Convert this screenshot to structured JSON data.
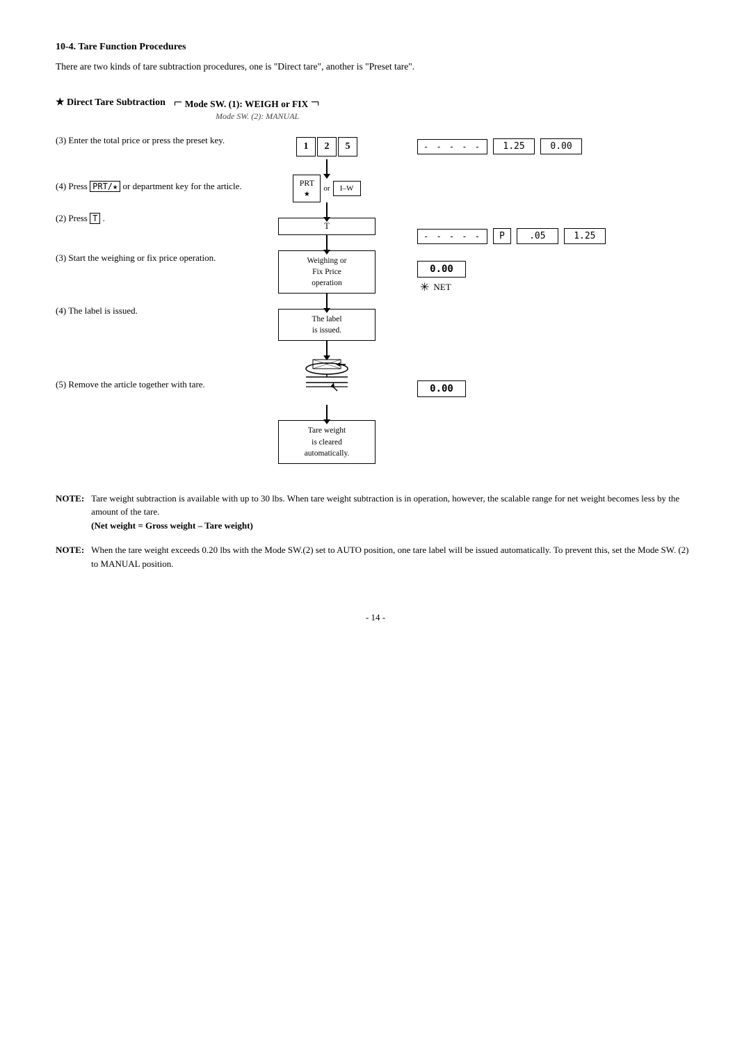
{
  "section": {
    "title": "10-4. Tare Function Procedures",
    "intro": "There are two kinds of tare subtraction procedures, one is \"Direct tare\", another is \"Preset tare\"."
  },
  "direct_tare": {
    "star_label": "★ Direct Tare Subtraction",
    "mode_label": "Mode SW. (1): WEIGH or FIX",
    "mode_sub": "Mode SW. (2): MANUAL"
  },
  "steps": [
    {
      "num": "(3)",
      "text": "Enter the total price or press the preset key."
    },
    {
      "num": "(4)",
      "text": "Press PRT/* or department key for the article."
    },
    {
      "num": "(2)",
      "text": "Press T ."
    },
    {
      "num": "(3)",
      "text": "Start the weighing or fix price operation."
    },
    {
      "num": "(4)",
      "text": "The label is issued."
    },
    {
      "num": "(5)",
      "text": "Remove the article together with tare."
    }
  ],
  "flowchart": {
    "keypad_digits": [
      "1",
      "2",
      "5"
    ],
    "node_prt": "PRT",
    "node_or": "or",
    "node_dept": "I-W",
    "node_t": "T",
    "node_weighing": [
      "Weighing or",
      "Fix Price",
      "operation"
    ],
    "node_label_issued": [
      "The label",
      "is issued."
    ],
    "node_tare_cleared": [
      "Tare weight",
      "is cleared",
      "automatically."
    ]
  },
  "readouts": {
    "row1_dots": "- - - - -",
    "row1_price": "1.25",
    "row1_total": "0.00",
    "row2_dots": "- - - - -",
    "row2_p": "P",
    "row2_val1": ".05",
    "row2_val2": "1.25",
    "row3_weight": "0.00",
    "net_label": "NET",
    "tare_cleared_val": "0.00"
  },
  "notes": [
    {
      "label": "NOTE:",
      "text": "Tare weight subtraction is available with up to 30 lbs. When tare weight subtraction is in operation, however, the scalable range for net weight becomes less by the amount of the tare.",
      "formula": "(Net weight = Gross weight – Tare weight)"
    },
    {
      "label": "NOTE:",
      "text": "When the tare weight exceeds 0.20 lbs with the Mode SW.(2) set to AUTO position, one tare label will be issued automatically. To prevent this, set the Mode SW. (2) to MANUAL position.",
      "formula": ""
    }
  ],
  "page": "- 14 -"
}
